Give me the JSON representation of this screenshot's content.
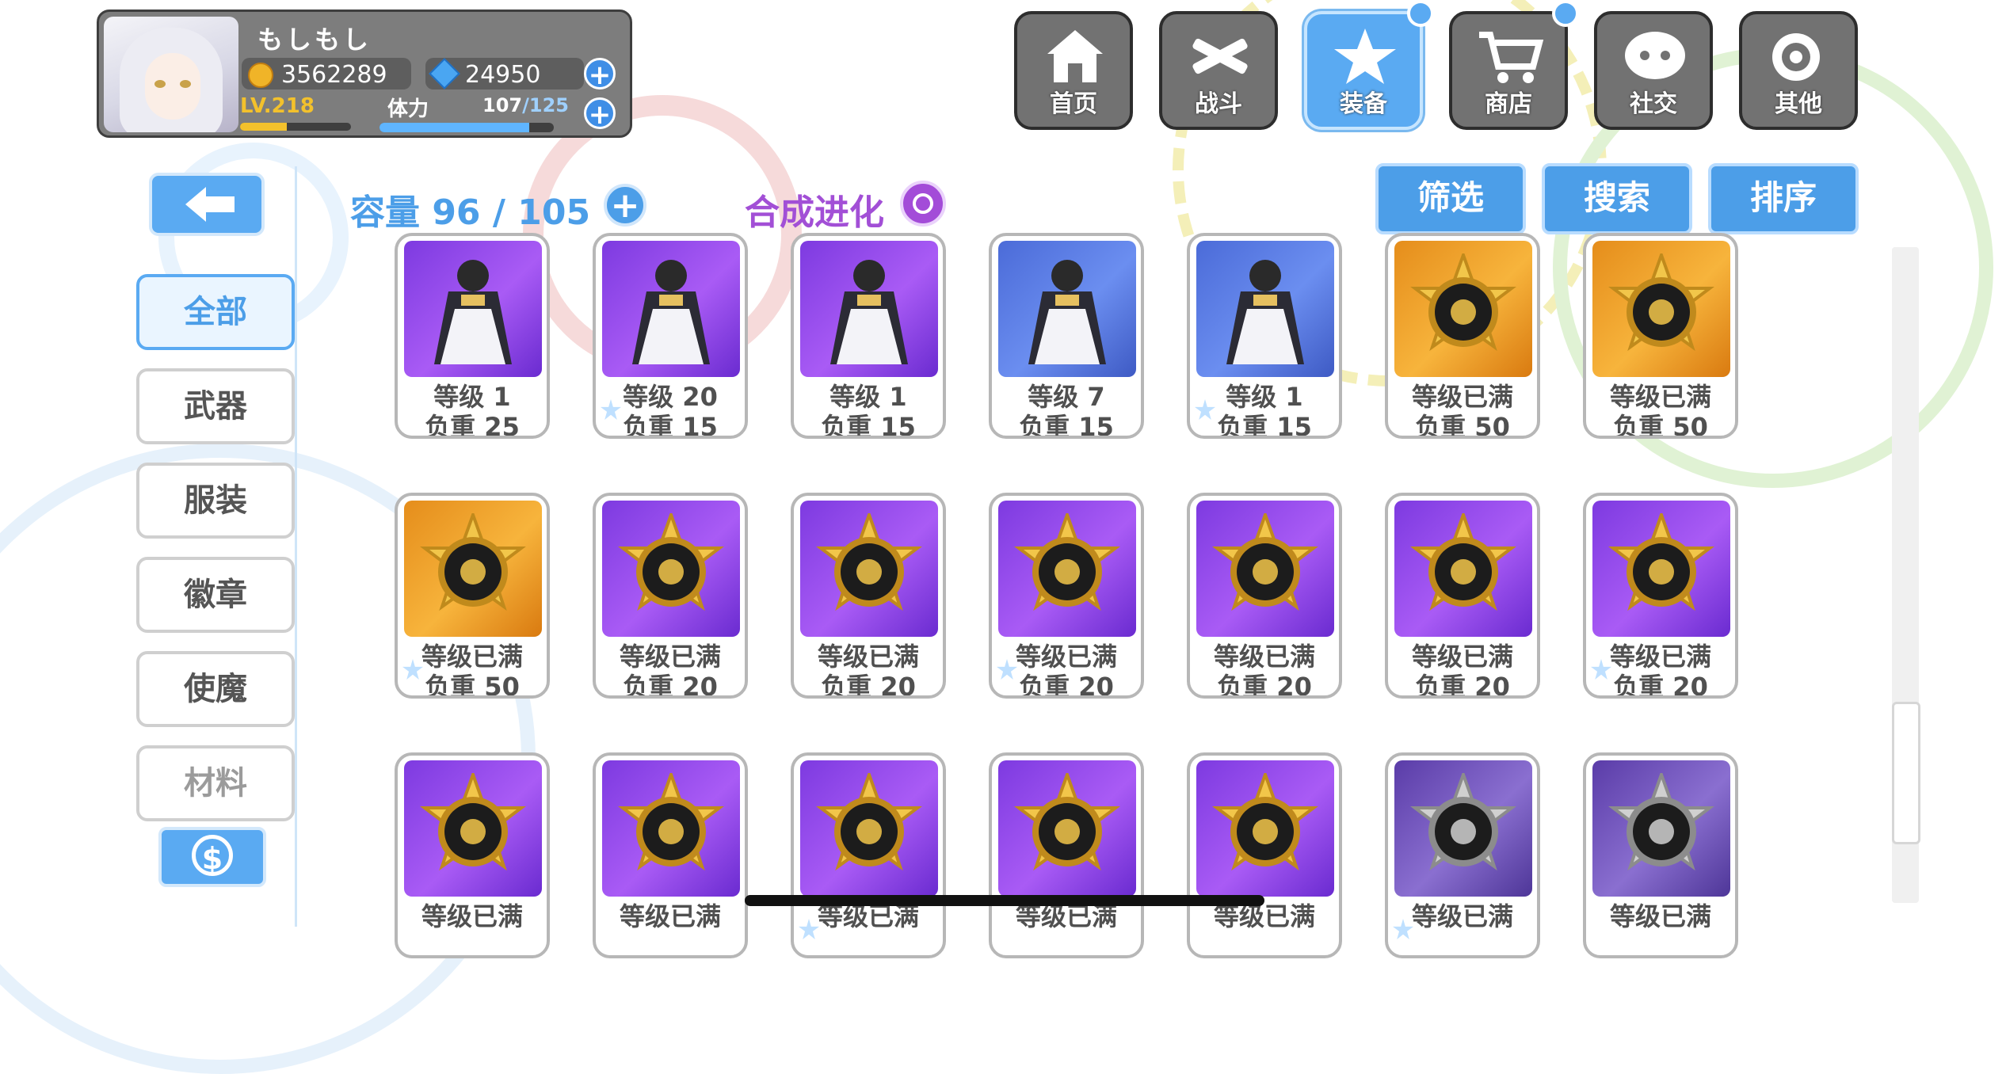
{
  "profile": {
    "username": "もしもし",
    "gold": "3562289",
    "gems": "24950",
    "level": "LV.218",
    "level_progress": 0.42,
    "stamina_label": "体力",
    "stamina_current": "107",
    "stamina_max": "/125",
    "stamina_progress": 0.86
  },
  "nav": [
    {
      "label": "首页",
      "icon": "house-icon",
      "active": false,
      "badge": false
    },
    {
      "label": "战斗",
      "icon": "crossed-guns-icon",
      "active": false,
      "badge": false
    },
    {
      "label": "装备",
      "icon": "star-gun-icon",
      "active": true,
      "badge": true
    },
    {
      "label": "商店",
      "icon": "cart-icon",
      "active": false,
      "badge": true
    },
    {
      "label": "社交",
      "icon": "mascot-icon",
      "active": false,
      "badge": false
    },
    {
      "label": "其他",
      "icon": "snail-icon",
      "active": false,
      "badge": false
    }
  ],
  "inventory": {
    "capacity_text": "容量 96 / 105",
    "synthesis_label": "合成进化",
    "filter_label": "筛选",
    "search_label": "搜索",
    "sort_label": "排序"
  },
  "sidebar": {
    "tabs": [
      {
        "label": "全部",
        "active": true
      },
      {
        "label": "武器",
        "active": false
      },
      {
        "label": "服装",
        "active": false
      },
      {
        "label": "徽章",
        "active": false
      },
      {
        "label": "使魔",
        "active": false
      },
      {
        "label": "材料",
        "active": false
      }
    ]
  },
  "items": [
    {
      "level": "等级 1",
      "weight": "负重 25",
      "kind": "costume",
      "bg": "purple"
    },
    {
      "level": "等级 20",
      "weight": "负重 15",
      "kind": "costume",
      "bg": "purple"
    },
    {
      "level": "等级 1",
      "weight": "负重 15",
      "kind": "costume",
      "bg": "purple"
    },
    {
      "level": "等级 7",
      "weight": "负重 15",
      "kind": "costume",
      "bg": "blue"
    },
    {
      "level": "等级 1",
      "weight": "负重 15",
      "kind": "costume",
      "bg": "blue"
    },
    {
      "level": "等级已满",
      "weight": "负重 50",
      "kind": "badge",
      "bg": "orange"
    },
    {
      "level": "等级已满",
      "weight": "负重 50",
      "kind": "badge",
      "bg": "orange"
    },
    {
      "level": "等级已满",
      "weight": "负重 50",
      "kind": "badge",
      "bg": "orange"
    },
    {
      "level": "等级已满",
      "weight": "负重 20",
      "kind": "badge",
      "bg": "purple"
    },
    {
      "level": "等级已满",
      "weight": "负重 20",
      "kind": "badge",
      "bg": "purple"
    },
    {
      "level": "等级已满",
      "weight": "负重 20",
      "kind": "badge",
      "bg": "purple"
    },
    {
      "level": "等级已满",
      "weight": "负重 20",
      "kind": "badge",
      "bg": "purple"
    },
    {
      "level": "等级已满",
      "weight": "负重 20",
      "kind": "badge",
      "bg": "purple"
    },
    {
      "level": "等级已满",
      "weight": "负重 20",
      "kind": "badge",
      "bg": "purple"
    },
    {
      "level": "等级已满",
      "weight": "",
      "kind": "badge",
      "bg": "purple"
    },
    {
      "level": "等级已满",
      "weight": "",
      "kind": "badge",
      "bg": "purple"
    },
    {
      "level": "等级已满",
      "weight": "",
      "kind": "badge",
      "bg": "purple"
    },
    {
      "level": "等级已满",
      "weight": "",
      "kind": "badge",
      "bg": "purple"
    },
    {
      "level": "等级已满",
      "weight": "",
      "kind": "badge",
      "bg": "purple"
    },
    {
      "level": "等级已满",
      "weight": "",
      "kind": "badge",
      "bg": "silver"
    },
    {
      "level": "等级已满",
      "weight": "",
      "kind": "badge",
      "bg": "silver"
    }
  ],
  "colors": {
    "accent": "#4c9ee8",
    "synthesis": "#a24fd6",
    "gold": "#f3c12c"
  }
}
